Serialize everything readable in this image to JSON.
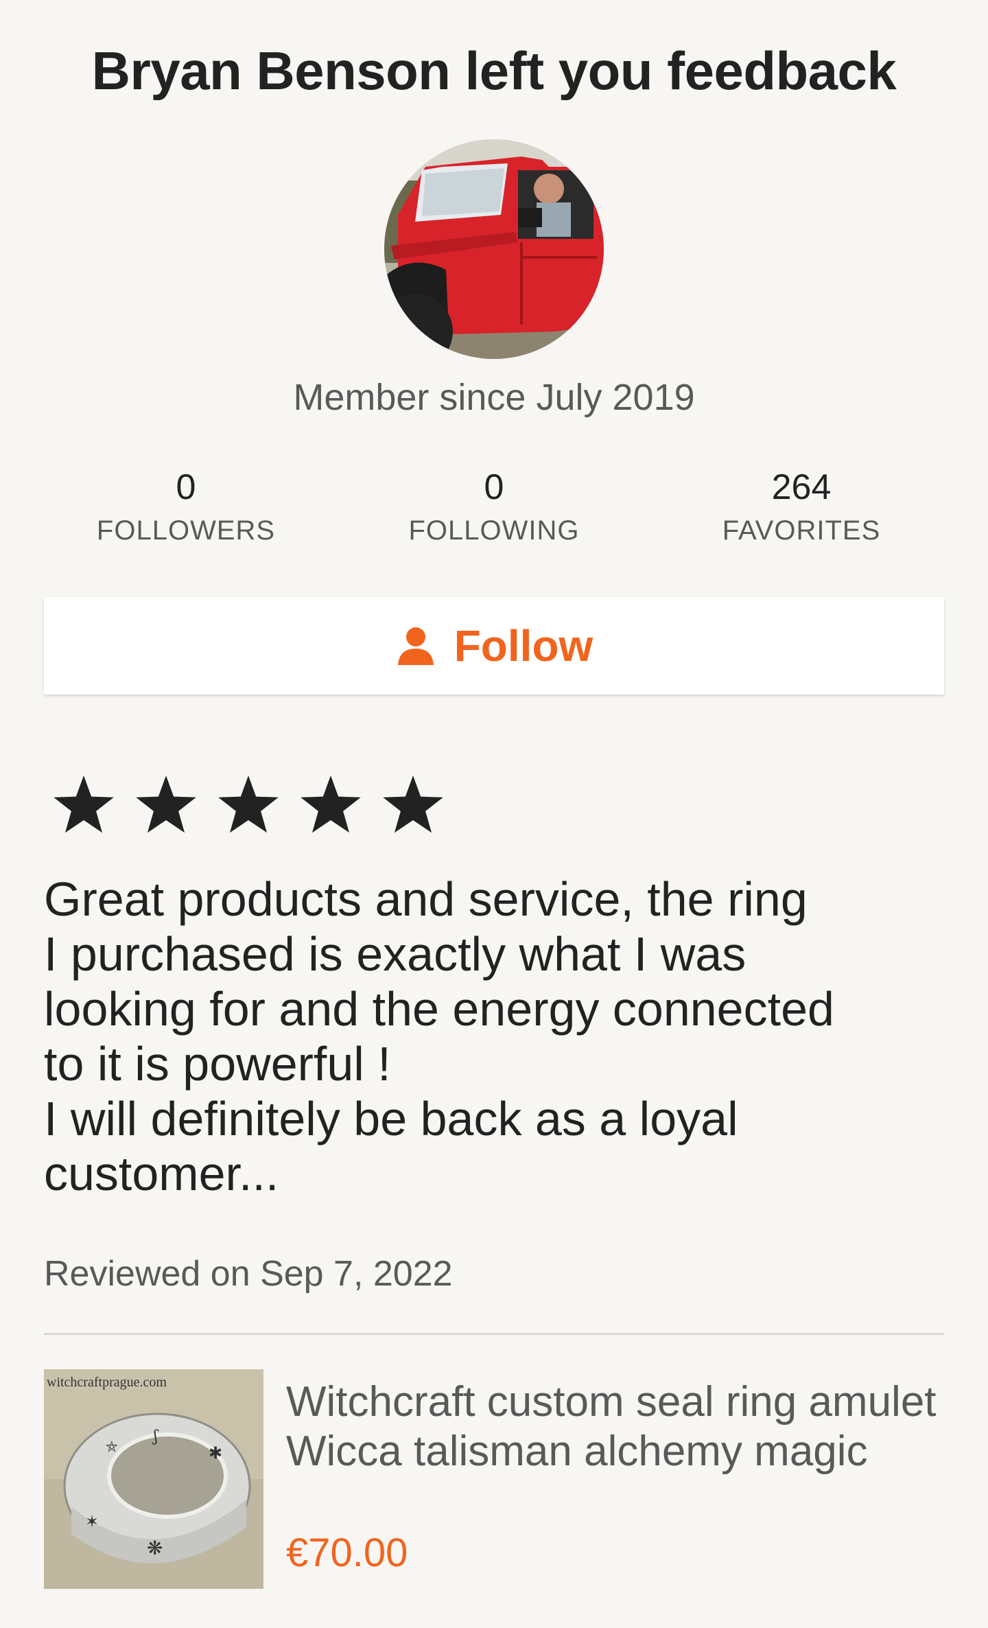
{
  "header": {
    "title": "Bryan Benson left you feedback"
  },
  "profile": {
    "avatar_icon": "avatar-photo",
    "member_since": "Member since July 2019"
  },
  "stats": [
    {
      "value": "0",
      "label": "FOLLOWERS"
    },
    {
      "value": "0",
      "label": "FOLLOWING"
    },
    {
      "value": "264",
      "label": "FAVORITES"
    }
  ],
  "follow": {
    "label": "Follow",
    "icon": "person-icon",
    "color": "#f1641e"
  },
  "review": {
    "rating": 5,
    "rating_max": 5,
    "text": "Great products and service, the ring\nI purchased is exactly what I was\nlooking for and the energy connected\nto it is powerful !\nI will definitely be back as a loyal\ncustomer...",
    "reviewed_on": "Reviewed on Sep 7, 2022"
  },
  "product": {
    "image_watermark": "witchcraftprague.com",
    "title": "Witchcraft custom seal ring amulet Wicca talisman alchemy magic",
    "price": "€70.00",
    "price_color": "#f1641e"
  }
}
